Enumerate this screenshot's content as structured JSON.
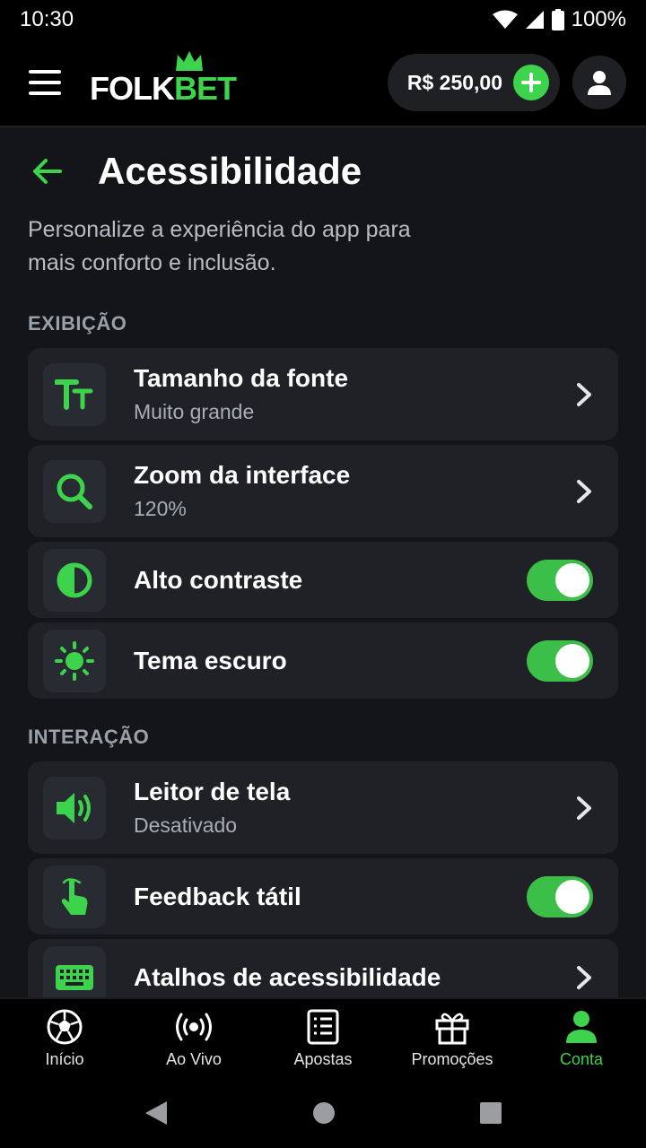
{
  "status": {
    "time": "10:30",
    "battery": "100%"
  },
  "header": {
    "logo_part1": "FOLK",
    "logo_part2": "BET",
    "balance": "R$ 250,00"
  },
  "page": {
    "title": "Acessibilidade",
    "description": "Personalize a experiência do app para mais conforto e inclusão."
  },
  "sections": {
    "display": {
      "label": "EXIBIÇÃO",
      "font_size": {
        "title": "Tamanho da fonte",
        "value": "Muito grande"
      },
      "zoom": {
        "title": "Zoom da interface",
        "value": "120%"
      },
      "high_contrast": {
        "title": "Alto contraste",
        "enabled": true
      },
      "dark_theme": {
        "title": "Tema escuro",
        "enabled": true
      }
    },
    "interaction": {
      "label": "INTERAÇÃO",
      "screen_reader": {
        "title": "Leitor de tela",
        "value": "Desativado"
      },
      "haptic": {
        "title": "Feedback tátil",
        "enabled": true
      },
      "shortcuts": {
        "title": "Atalhos de acessibilidade"
      }
    }
  },
  "bottom_nav": {
    "items": [
      {
        "label": "Início",
        "icon": "soccer-ball-icon"
      },
      {
        "label": "Ao Vivo",
        "icon": "live-broadcast-icon"
      },
      {
        "label": "Apostas",
        "icon": "bet-slip-icon"
      },
      {
        "label": "Promoções",
        "icon": "gift-icon"
      },
      {
        "label": "Conta",
        "icon": "person-icon",
        "active": true
      }
    ]
  },
  "colors": {
    "accent": "#3dd34c",
    "background": "#141518",
    "card": "#1f2126",
    "toggle_on": "#3cbf48"
  }
}
